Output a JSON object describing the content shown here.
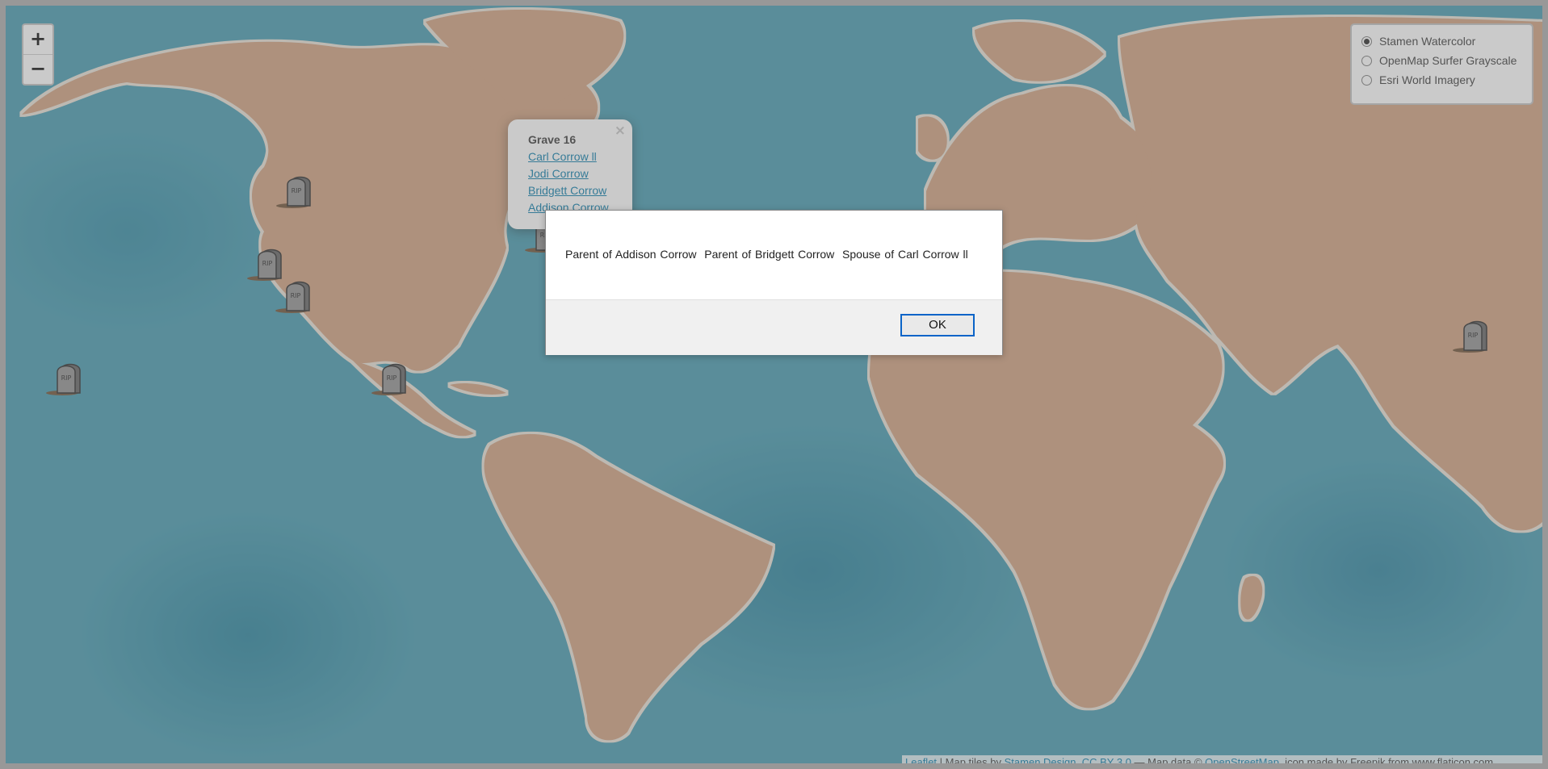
{
  "zoom": {
    "in_label": "+",
    "out_label": "−"
  },
  "layers": {
    "options": [
      {
        "label": "Stamen Watercolor",
        "checked": true
      },
      {
        "label": "OpenMap Surfer Grayscale",
        "checked": false
      },
      {
        "label": "Esri World Imagery",
        "checked": false
      }
    ]
  },
  "popup": {
    "close": "×",
    "title": "Grave 16",
    "links": [
      "Carl Corrow ll",
      "Jodi Corrow",
      "Bridgett Corrow",
      "Addison Corrow"
    ]
  },
  "marker": {
    "icon": "rip-tombstone-icon",
    "text": "RIP"
  },
  "attribution": {
    "leaflet": "Leaflet",
    "sep1": " | Map tiles by ",
    "stamen": "Stamen Design",
    "comma": ", ",
    "cc": "CC BY 3.0",
    "data": " — Map data © ",
    "osm": "OpenStreetMap",
    "tail": ", icon made by Freepik from www.flaticon.com"
  },
  "dialog": {
    "message": "Parent of Addison Corrow  Parent of Bridgett Corrow  Spouse of Carl Corrow ll",
    "ok_label": "OK"
  }
}
